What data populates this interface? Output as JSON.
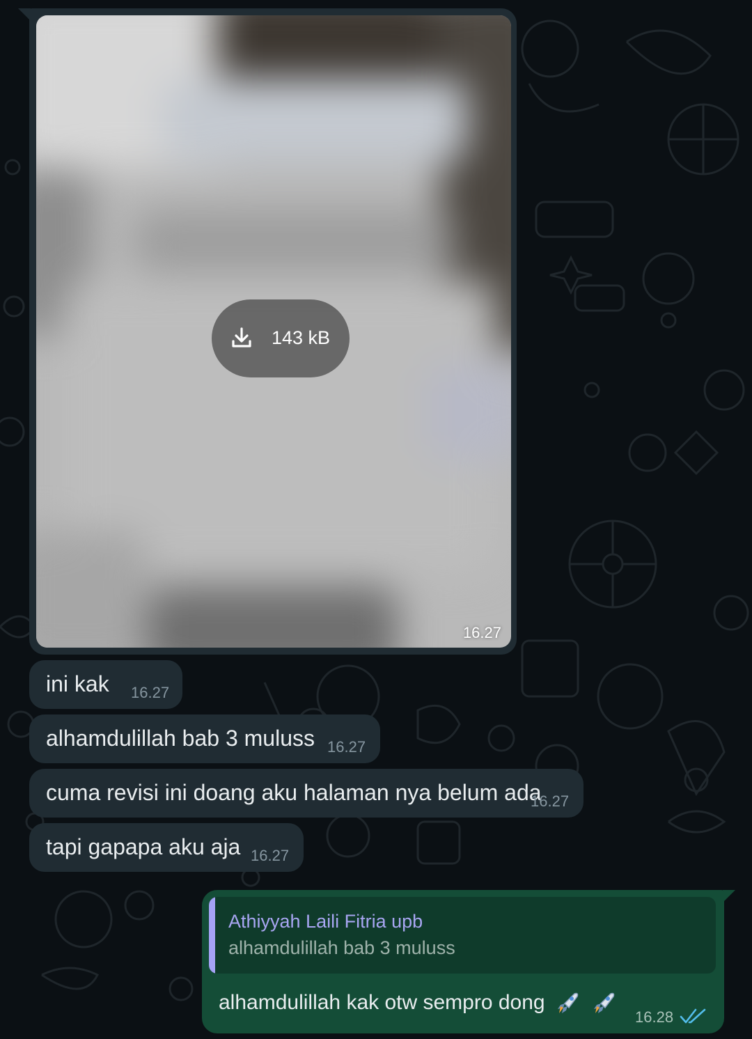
{
  "chat": {
    "messages_in": [
      {
        "text": "ini kak",
        "time": "16.27"
      },
      {
        "text": "alhamdulillah bab 3 muluss",
        "time": "16.27"
      },
      {
        "text": "cuma revisi ini doang aku halaman nya belum ada",
        "time": "16.27"
      },
      {
        "text": "tapi gapapa aku aja",
        "time": "16.27"
      }
    ],
    "image_message": {
      "download_size": "143 kB",
      "time": "16.27",
      "download_icon": "download-icon"
    },
    "outgoing": {
      "quoted_author": "Athiyyah Laili Fitria upb",
      "quoted_text": "alhamdulillah bab 3 muluss",
      "text": "alhamdulillah kak otw sempro dong",
      "emojis": [
        "rocket",
        "rocket"
      ],
      "time": "16.28",
      "status_icon": "double-check-read-icon"
    }
  },
  "colors": {
    "background": "#0b1014",
    "incoming_bubble": "#202c33",
    "outgoing_bubble": "#144d37",
    "quote_bar": "#a5a2f5",
    "read_ticks": "#53bdeb"
  }
}
